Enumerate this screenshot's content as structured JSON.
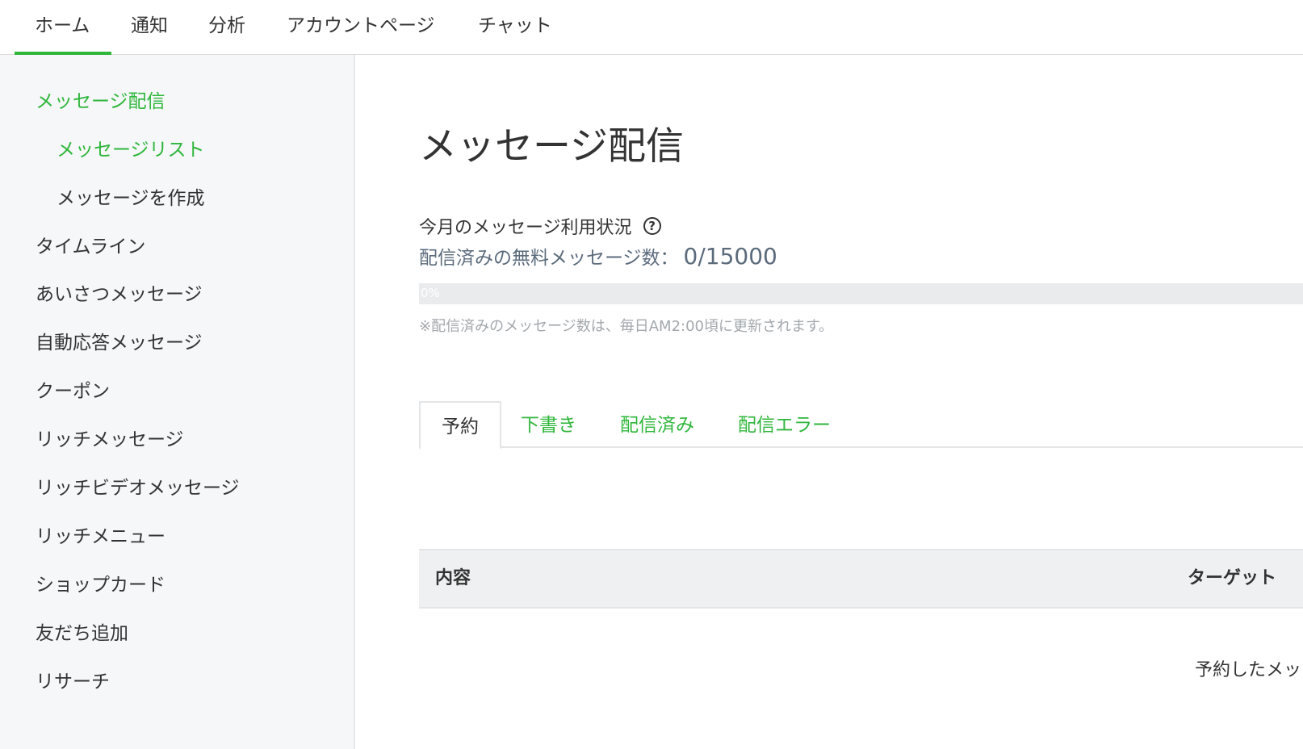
{
  "topnav": {
    "tabs": [
      "ホーム",
      "通知",
      "分析",
      "アカウントページ",
      "チャット"
    ],
    "active_index": 0
  },
  "sidebar": {
    "items": [
      {
        "label": "メッセージ配信",
        "active": true
      },
      {
        "label": "メッセージリスト",
        "active": true
      },
      {
        "label": "メッセージを作成",
        "active": false
      },
      {
        "label": "タイムライン",
        "active": false
      },
      {
        "label": "あいさつメッセージ",
        "active": false
      },
      {
        "label": "自動応答メッセージ",
        "active": false
      },
      {
        "label": "クーポン",
        "active": false
      },
      {
        "label": "リッチメッセージ",
        "active": false
      },
      {
        "label": "リッチビデオメッセージ",
        "active": false
      },
      {
        "label": "リッチメニュー",
        "active": false
      },
      {
        "label": "ショップカード",
        "active": false
      },
      {
        "label": "友だち追加",
        "active": false
      },
      {
        "label": "リサーチ",
        "active": false
      }
    ]
  },
  "main": {
    "title": "メッセージ配信",
    "usage": {
      "heading": "今月のメッセージ利用状況",
      "help_icon": "?",
      "sent_label": "配信済みの無料メッセージ数：",
      "sent_value": "0/15000",
      "progress_percent": 0,
      "progress_text": "0%",
      "note": "※配信済みのメッセージ数は、毎日AM2:00頃に更新されます。"
    },
    "tabs": [
      "予約",
      "下書き",
      "配信済み",
      "配信エラー"
    ],
    "active_tab": 0,
    "table": {
      "headers": [
        "内容",
        "ターゲット"
      ],
      "empty_text": "予約したメッ"
    }
  },
  "colors": {
    "accent": "#2fb63b",
    "sidebar_bg": "#f5f7f8",
    "muted_text": "#a3a8ad"
  }
}
